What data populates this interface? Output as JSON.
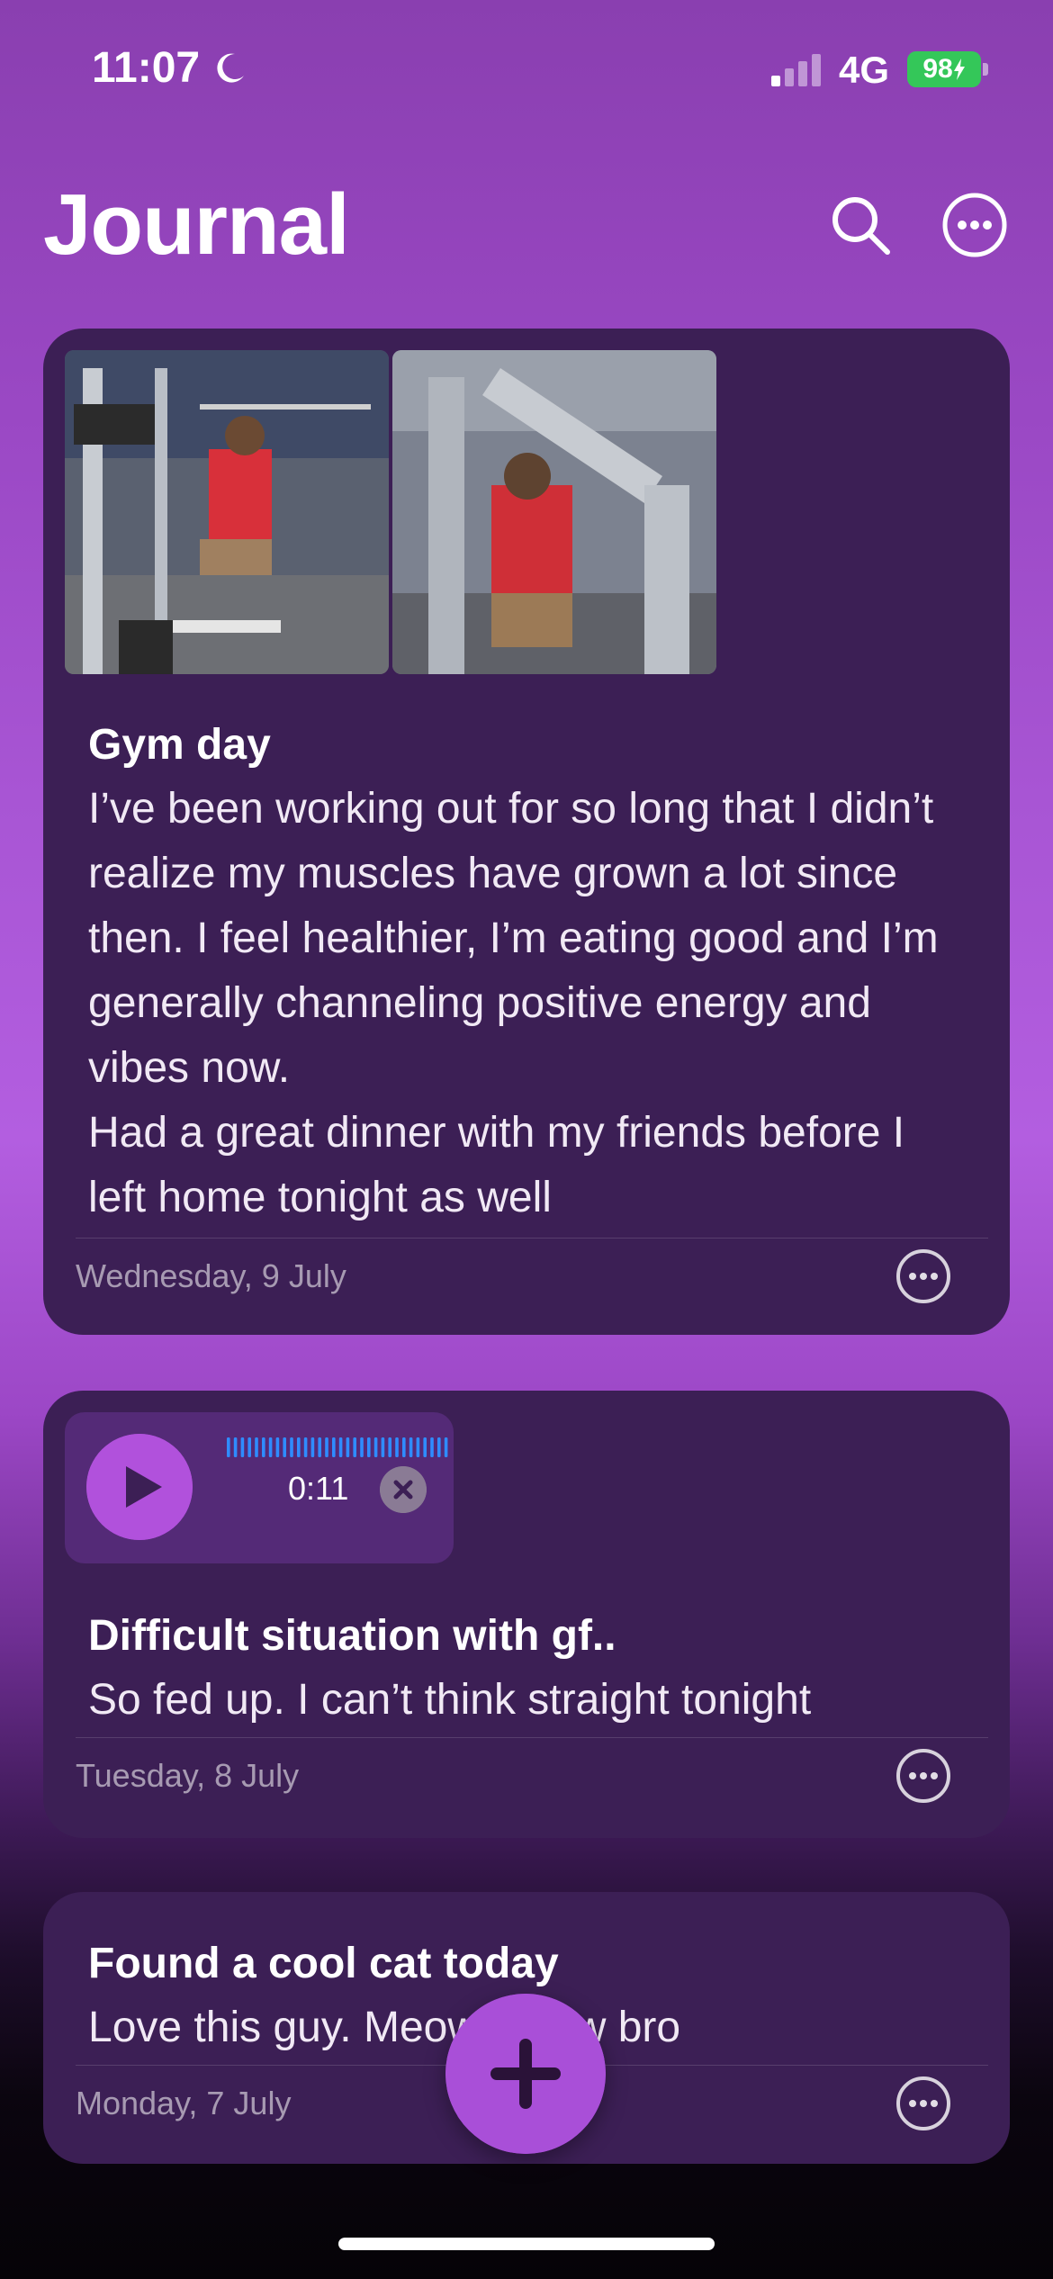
{
  "status_bar": {
    "time": "11:07",
    "network": "4G",
    "battery": "98",
    "moon_icon": "moon-icon",
    "signal_icon": "cellular-signal-icon"
  },
  "header": {
    "title": "Journal",
    "search_icon": "search-icon",
    "more_icon": "more-options-icon"
  },
  "entries": [
    {
      "title": "Gym day",
      "body": "I’ve been working out for so long that I didn’t realize my muscles have grown a lot since then. I feel healthier, I’m eating good and I’m generally channeling positive energy and vibes now.\nHad a great dinner with my friends before I left home tonight as well",
      "date": "Wednesday, 9 July",
      "photos": [
        "gym-photo-bench-press",
        "gym-photo-machine"
      ]
    },
    {
      "title": "Difficult situation with gf..",
      "body": "So fed up. I can’t think straight tonight",
      "date": "Tuesday, 8 July",
      "audio": {
        "duration": "0:11"
      }
    },
    {
      "title": "Found a cool cat today",
      "body": "Love this guy. Meow meow bro",
      "date": "Monday, 7 July"
    }
  ],
  "fab": {
    "icon": "plus-icon"
  },
  "colors": {
    "accent": "#a94fd8",
    "card": "#3c1f55",
    "battery": "#34c759",
    "waveform": "#2f8cff"
  }
}
